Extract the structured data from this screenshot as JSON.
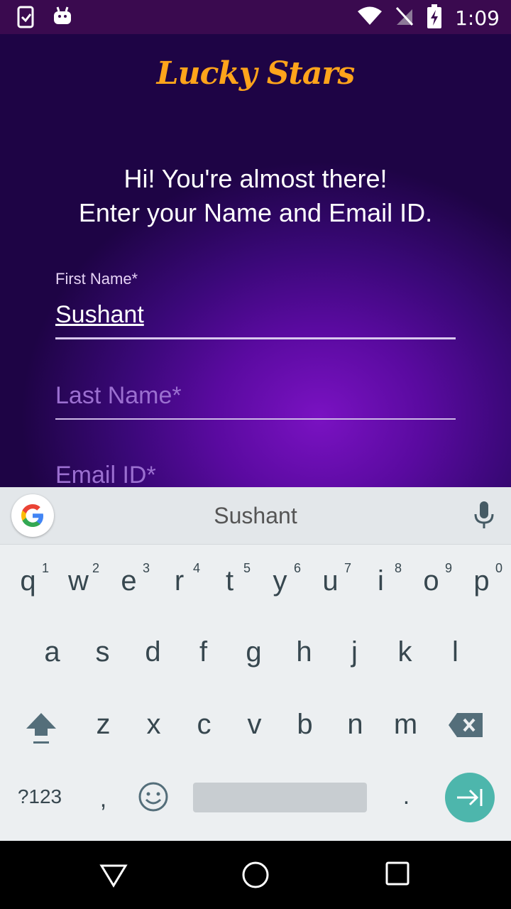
{
  "status": {
    "time": "1:09"
  },
  "app": {
    "title": "Lucky Stars",
    "intro_line1": "Hi! You're almost there!",
    "intro_line2": "Enter your Name and Email ID."
  },
  "form": {
    "first_name": {
      "label": "First Name*",
      "value": "Sushant"
    },
    "last_name": {
      "placeholder": "Last Name*"
    },
    "email": {
      "placeholder": "Email ID*"
    }
  },
  "keyboard": {
    "suggestion": "Sushant",
    "row1": [
      {
        "k": "q",
        "h": "1"
      },
      {
        "k": "w",
        "h": "2"
      },
      {
        "k": "e",
        "h": "3"
      },
      {
        "k": "r",
        "h": "4"
      },
      {
        "k": "t",
        "h": "5"
      },
      {
        "k": "y",
        "h": "6"
      },
      {
        "k": "u",
        "h": "7"
      },
      {
        "k": "i",
        "h": "8"
      },
      {
        "k": "o",
        "h": "9"
      },
      {
        "k": "p",
        "h": "0"
      }
    ],
    "row2": [
      "a",
      "s",
      "d",
      "f",
      "g",
      "h",
      "j",
      "k",
      "l"
    ],
    "row3": [
      "z",
      "x",
      "c",
      "v",
      "b",
      "n",
      "m"
    ],
    "symbols_label": "?123",
    "comma": ",",
    "period": "."
  },
  "colors": {
    "accent": "#ffa41b",
    "enter": "#4db6ac"
  }
}
